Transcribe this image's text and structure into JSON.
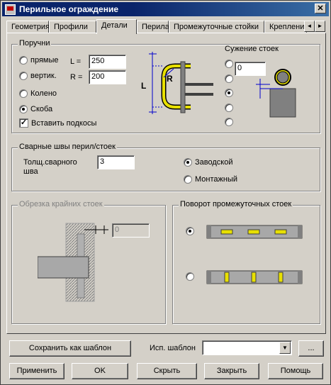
{
  "window": {
    "title": "Перильное ограждение",
    "close_label": "✕"
  },
  "tabs": [
    "Геометрия",
    "Профили",
    "Детали",
    "Перила",
    "Промежуточные стойки",
    "Крепление"
  ],
  "tab_scroll": {
    "left": "◄",
    "right": "►"
  },
  "handrails": {
    "title": "Поручни",
    "options": [
      "прямые",
      "вертик.",
      "Колено",
      "Скоба"
    ],
    "selected": "Скоба",
    "L_label": "L =",
    "L_value": "250",
    "R_label": "R =",
    "R_value": "200",
    "braces_label": "Вставить подкосы",
    "braces_checked": true,
    "diagram_L": "L",
    "diagram_R": "R"
  },
  "post_narrowing": {
    "title": "Сужение стоек",
    "value": "0",
    "selected_index": 2
  },
  "welds": {
    "title": "Сварные швы перил/стоек",
    "thickness_label_1": "Толщ.сварного",
    "thickness_label_2": "шва",
    "thickness_value": "3",
    "options": [
      "Заводской",
      "Монтажный"
    ],
    "selected": "Заводской"
  },
  "edge_trim": {
    "title": "Обрезка крайних стоек",
    "value": "0"
  },
  "rotation": {
    "title": "Поворот промежуточных стоек",
    "selected_index": 0
  },
  "template": {
    "save_label": "Сохранить как шаблон",
    "use_label": "Исп. шаблон",
    "value": "",
    "browse_label": "..."
  },
  "buttons": {
    "apply": "Применить",
    "ok": "OK",
    "hide": "Скрыть",
    "close": "Закрыть",
    "help": "Помощь"
  },
  "colors": {
    "title_bar": "#0a246a",
    "rail_fill": "#e8e000",
    "dim_line": "#0000cc",
    "face": "#d4d0c8"
  }
}
